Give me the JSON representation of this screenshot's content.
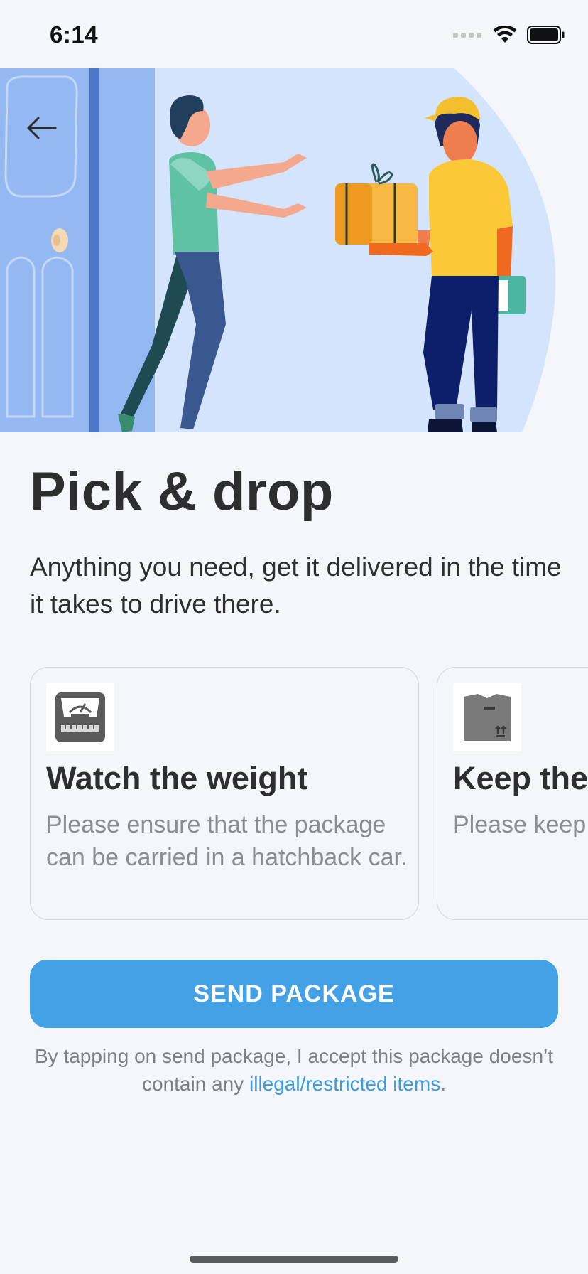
{
  "status_bar": {
    "time": "6:14"
  },
  "hero": {
    "back_icon": "arrow-left-icon",
    "illustration": "courier-handing-package-at-door"
  },
  "header": {
    "title": "Pick & drop",
    "subtitle": "Anything you need, get it delivered in the time it takes to drive there."
  },
  "cards": [
    {
      "icon": "weighing-scale-icon",
      "title": "Watch the weight",
      "text": "Please ensure that the package can be carried in a hatchback car."
    },
    {
      "icon": "package-box-icon",
      "title": "Keep the",
      "text": "Please keep before the p pickup."
    }
  ],
  "cta": {
    "label": "SEND PACKAGE"
  },
  "disclaimer": {
    "text": "By tapping on send package, I accept this package doesn’t contain any",
    "link": "illegal/restricted items."
  },
  "colors": {
    "accent": "#43a2e6",
    "link": "#3a9be0",
    "background": "#f4f6f9"
  }
}
